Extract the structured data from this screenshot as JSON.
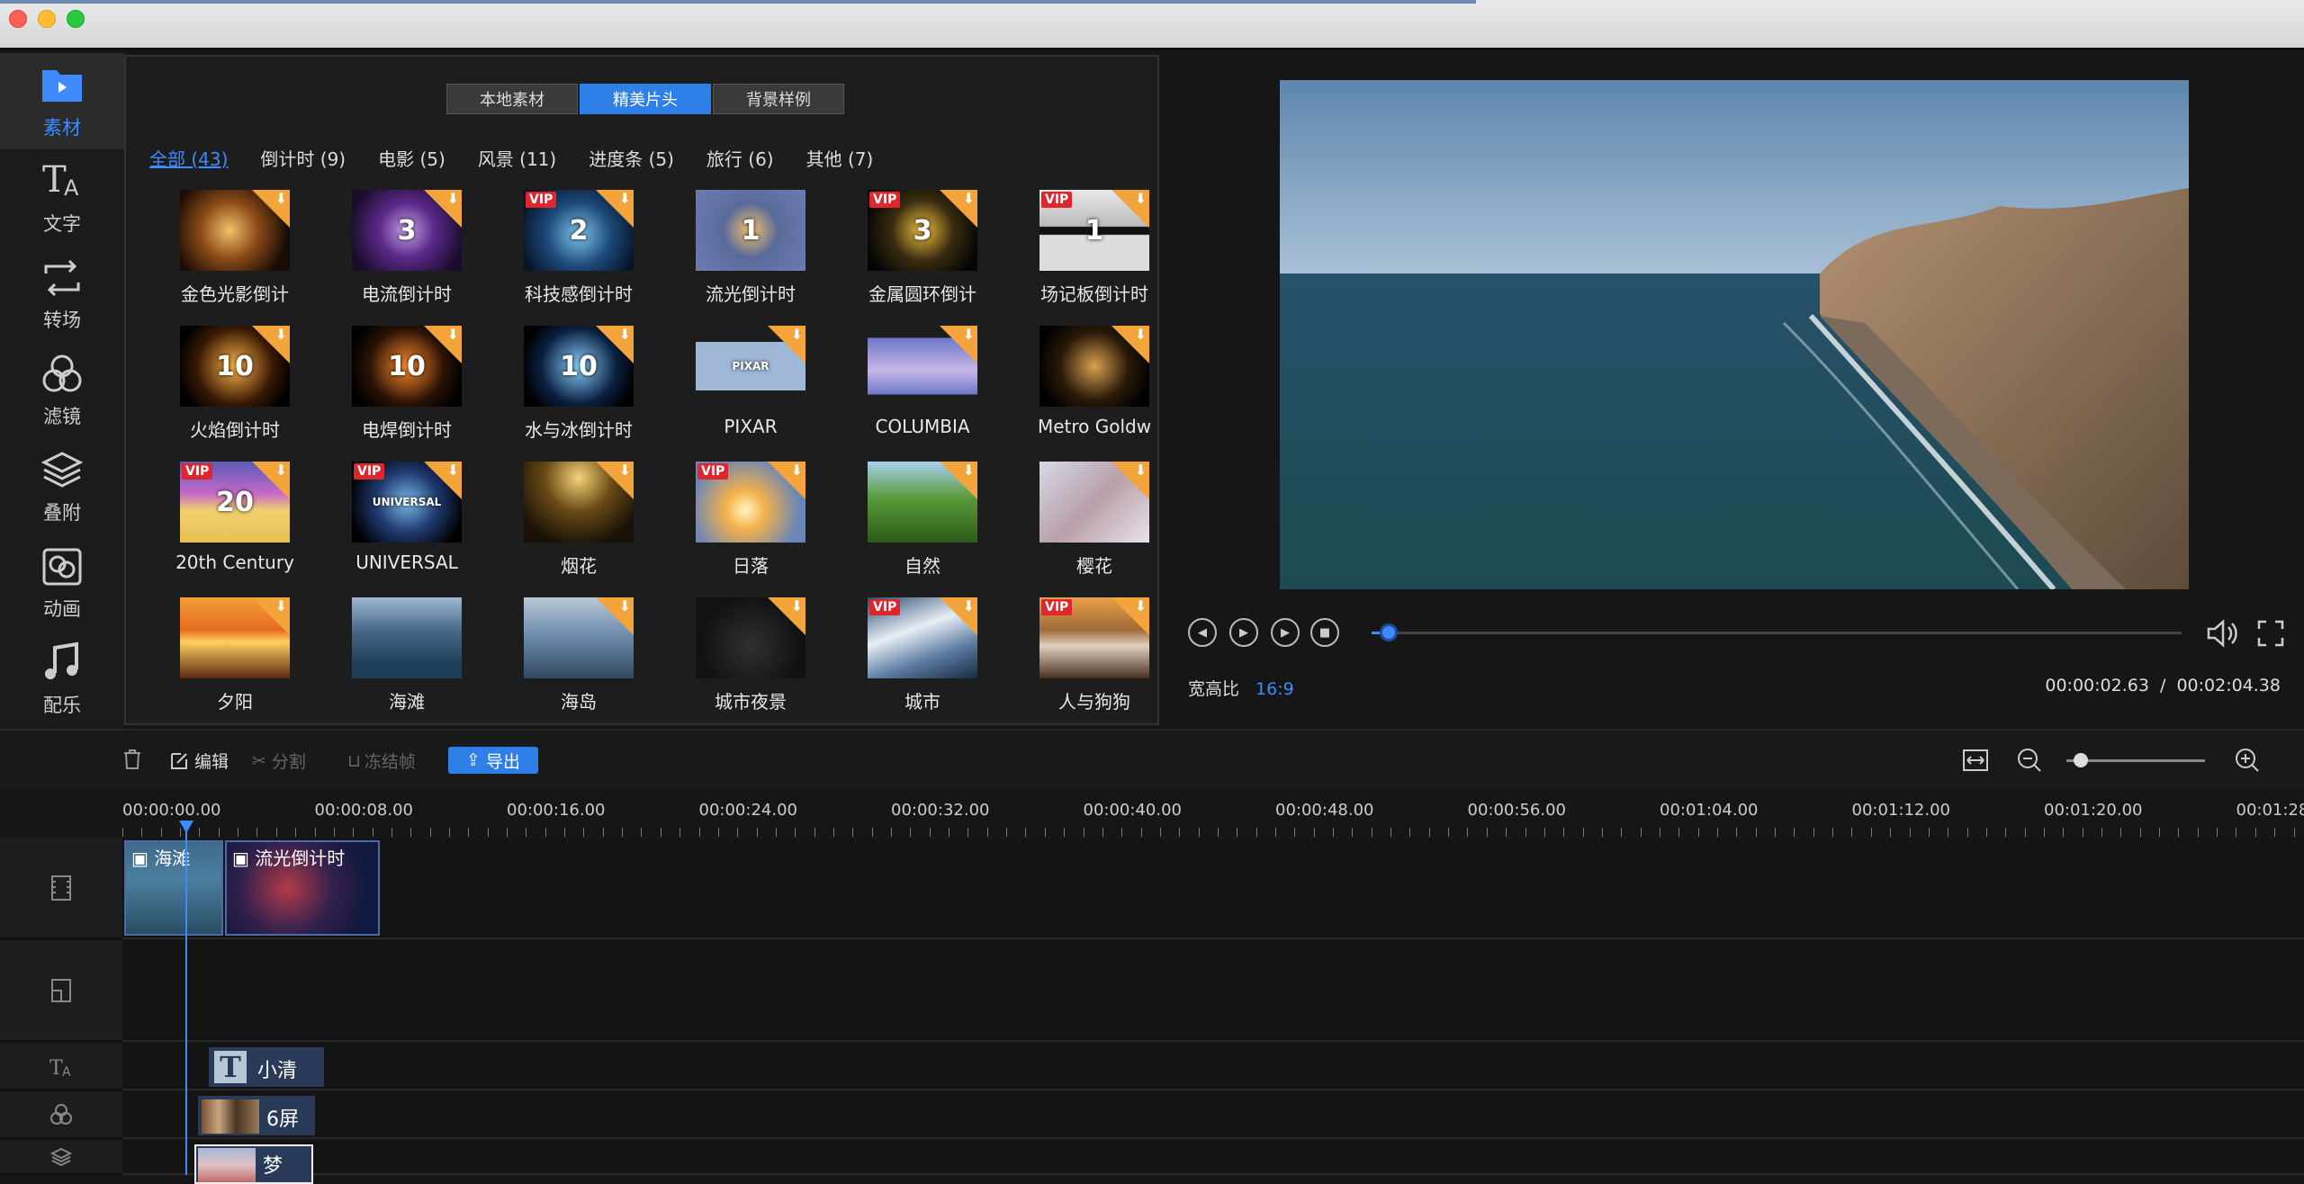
{
  "colors": {
    "accent": "#3d8bff",
    "download_badge": "#f3a43a",
    "vip_badge": "#e0262d"
  },
  "sidebar": {
    "items": [
      {
        "label": "素材",
        "icon": "folder-play-icon",
        "active": true
      },
      {
        "label": "文字",
        "icon": "text-icon"
      },
      {
        "label": "转场",
        "icon": "transition-icon"
      },
      {
        "label": "滤镜",
        "icon": "filter-icon"
      },
      {
        "label": "叠附",
        "icon": "overlay-layers-icon"
      },
      {
        "label": "动画",
        "icon": "animation-icon"
      },
      {
        "label": "配乐",
        "icon": "music-note-icon"
      }
    ]
  },
  "library": {
    "tabs": [
      {
        "label": "本地素材"
      },
      {
        "label": "精美片头",
        "active": true
      },
      {
        "label": "背景样例"
      }
    ],
    "categories": [
      {
        "label": "全部 (43)",
        "active": true
      },
      {
        "label": "倒计时 (9)"
      },
      {
        "label": "电影 (5)"
      },
      {
        "label": "风景 (11)"
      },
      {
        "label": "进度条 (5)"
      },
      {
        "label": "旅行 (6)"
      },
      {
        "label": "其他 (7)"
      }
    ],
    "vip_text": "VIP",
    "download_glyph": "⬇",
    "items": [
      {
        "label": "金色光影倒计",
        "vip": false,
        "dl": true
      },
      {
        "label": "电流倒计时",
        "vip": false,
        "dl": true,
        "thumb_text": "3"
      },
      {
        "label": "科技感倒计时",
        "vip": true,
        "dl": true,
        "thumb_text": "2"
      },
      {
        "label": "流光倒计时",
        "vip": false,
        "dl": false,
        "thumb_text": "1"
      },
      {
        "label": "金属圆环倒计",
        "vip": true,
        "dl": true,
        "thumb_text": "3"
      },
      {
        "label": "场记板倒计时",
        "vip": true,
        "dl": true,
        "thumb_text": "1"
      },
      {
        "label": "火焰倒计时",
        "vip": false,
        "dl": true,
        "thumb_text": "10"
      },
      {
        "label": "电焊倒计时",
        "vip": false,
        "dl": true,
        "thumb_text": "10"
      },
      {
        "label": "水与冰倒计时",
        "vip": false,
        "dl": true,
        "thumb_text": "10"
      },
      {
        "label": "PIXAR",
        "vip": false,
        "dl": true,
        "thumb_text": "PIXAR"
      },
      {
        "label": "COLUMBIA",
        "vip": false,
        "dl": true
      },
      {
        "label": "Metro Goldw",
        "vip": false,
        "dl": true
      },
      {
        "label": "20th Century",
        "vip": true,
        "dl": true,
        "thumb_text": "20"
      },
      {
        "label": "UNIVERSAL",
        "vip": true,
        "dl": true,
        "thumb_text": "UNIVERSAL"
      },
      {
        "label": "烟花",
        "vip": false,
        "dl": true
      },
      {
        "label": "日落",
        "vip": true,
        "dl": true
      },
      {
        "label": "自然",
        "vip": false,
        "dl": true
      },
      {
        "label": "樱花",
        "vip": false,
        "dl": true
      },
      {
        "label": "夕阳",
        "vip": false,
        "dl": true
      },
      {
        "label": "海滩",
        "vip": false,
        "dl": false
      },
      {
        "label": "海岛",
        "vip": false,
        "dl": true
      },
      {
        "label": "城市夜景",
        "vip": false,
        "dl": true
      },
      {
        "label": "城市",
        "vip": true,
        "dl": true
      },
      {
        "label": "人与狗狗",
        "vip": true,
        "dl": true
      }
    ]
  },
  "player": {
    "aspect_label": "宽高比",
    "aspect_value": "16:9",
    "current_time": "00:00:02.63",
    "separator": "/",
    "total_time": "00:02:04.38",
    "progress_fraction": 0.021
  },
  "toolbar": {
    "edit": "编辑",
    "split": "分割",
    "freeze": "冻结帧",
    "export": "导出"
  },
  "timeline": {
    "ticks": [
      "00:00:00.00",
      "00:00:08.00",
      "00:00:16.00",
      "00:00:24.00",
      "00:00:32.00",
      "00:00:40.00",
      "00:00:48.00",
      "00:00:56.00",
      "00:01:04.00",
      "00:01:12.00",
      "00:01:20.00",
      "00:01:28"
    ],
    "video_clips": [
      {
        "label": "海滩"
      },
      {
        "label": "流光倒计时"
      }
    ],
    "text_clip": {
      "glyph": "T",
      "label": "小清"
    },
    "filter_clip": {
      "label": "6屏"
    },
    "overlay_clip": {
      "label": "梦"
    }
  }
}
